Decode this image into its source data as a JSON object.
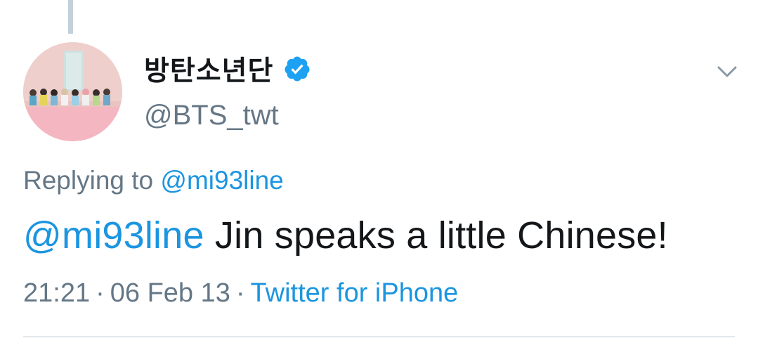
{
  "tweet": {
    "author": {
      "display_name": "방탄소년단",
      "handle": "@BTS_twt",
      "verified": true,
      "avatar_icon": "group-photo-avatar"
    },
    "reply": {
      "prefix": "Replying to",
      "mention": "@mi93line"
    },
    "body": {
      "mention": "@mi93line",
      "text": " Jin speaks a little Chinese!"
    },
    "meta": {
      "time": "21:21",
      "separator": "·",
      "date": "06 Feb 13",
      "source": "Twitter for iPhone"
    },
    "icons": {
      "verified": "verified-badge-icon",
      "menu": "chevron-down-icon"
    },
    "colors": {
      "link": "#1b95e0",
      "text": "#14171a",
      "secondary": "#657786",
      "verified": "#1da1f2",
      "divider": "#e1e8ed"
    }
  }
}
